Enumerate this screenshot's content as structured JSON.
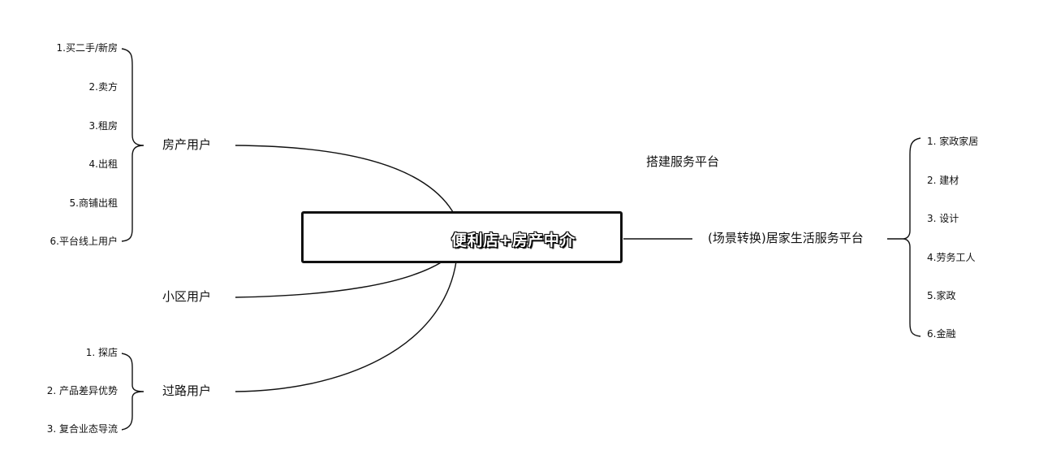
{
  "center": {
    "title": "便利店+房产中介"
  },
  "left": {
    "property_users": {
      "label": "房产用户",
      "items": [
        "1.买二手/新房",
        "2.卖方",
        "3.租房",
        "4.出租",
        "5.商铺出租",
        "6.平台线上用户"
      ]
    },
    "community_users": {
      "label": "小区用户"
    },
    "passing_users": {
      "label": "过路用户",
      "items": [
        "1. 探店",
        "2. 产品差异优势",
        "3. 复合业态导流"
      ]
    }
  },
  "right": {
    "top_label": "搭建服务平台",
    "platform": {
      "label": "(场景转换)居家生活服务平台",
      "items": [
        "1. 家政家居",
        "2. 建材",
        "3. 设计",
        "4.劳务工人",
        "5.家政",
        "6.金融"
      ]
    }
  }
}
